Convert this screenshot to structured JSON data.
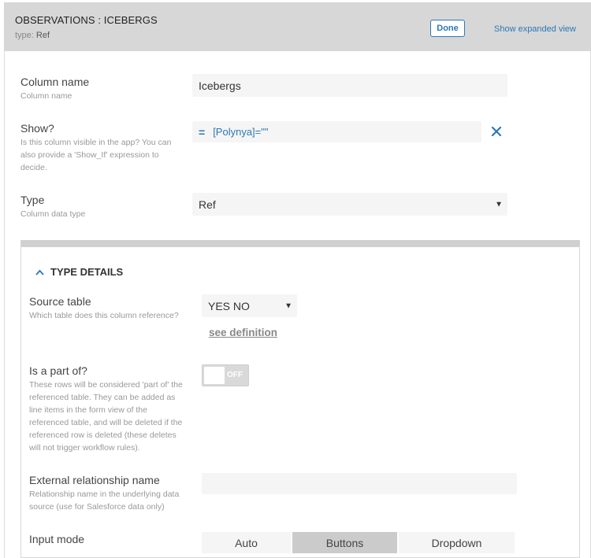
{
  "header": {
    "title": "OBSERVATIONS : ICEBERGS",
    "type_label": "type:",
    "type_value": "Ref",
    "done_label": "Done",
    "expand_label": "Show expanded view"
  },
  "column_name": {
    "label": "Column name",
    "sub": "Column name",
    "value": "Icebergs"
  },
  "show": {
    "label": "Show?",
    "sub": "Is this column visible in the app? You can also provide a 'Show_If' expression to decide.",
    "expr_icon": "equals-icon",
    "expression": "[Polynya]=\"\"",
    "clear_icon": "close-icon"
  },
  "type": {
    "label": "Type",
    "sub": "Column data type",
    "value": "Ref"
  },
  "type_details": {
    "title": "TYPE DETAILS",
    "source_table": {
      "label": "Source table",
      "sub": "Which table does this column reference?",
      "value": "YES NO",
      "link": "see definition"
    },
    "part_of": {
      "label": "Is a part of?",
      "sub": "These rows will be considered 'part of' the referenced table. They can be added as line items in the form view of the referenced table, and will be deleted if the referenced row is deleted (these deletes will not trigger workflow rules).",
      "toggle_text": "OFF"
    },
    "external": {
      "label": "External relationship name",
      "sub": "Relationship name in the underlying data source (use for Salesforce data only)",
      "value": ""
    },
    "input_mode": {
      "label": "Input mode",
      "options": [
        "Auto",
        "Buttons",
        "Dropdown"
      ],
      "selected": "Buttons"
    }
  },
  "colors": {
    "accent": "#2a78b8",
    "header_bg": "#d7d7d7"
  }
}
